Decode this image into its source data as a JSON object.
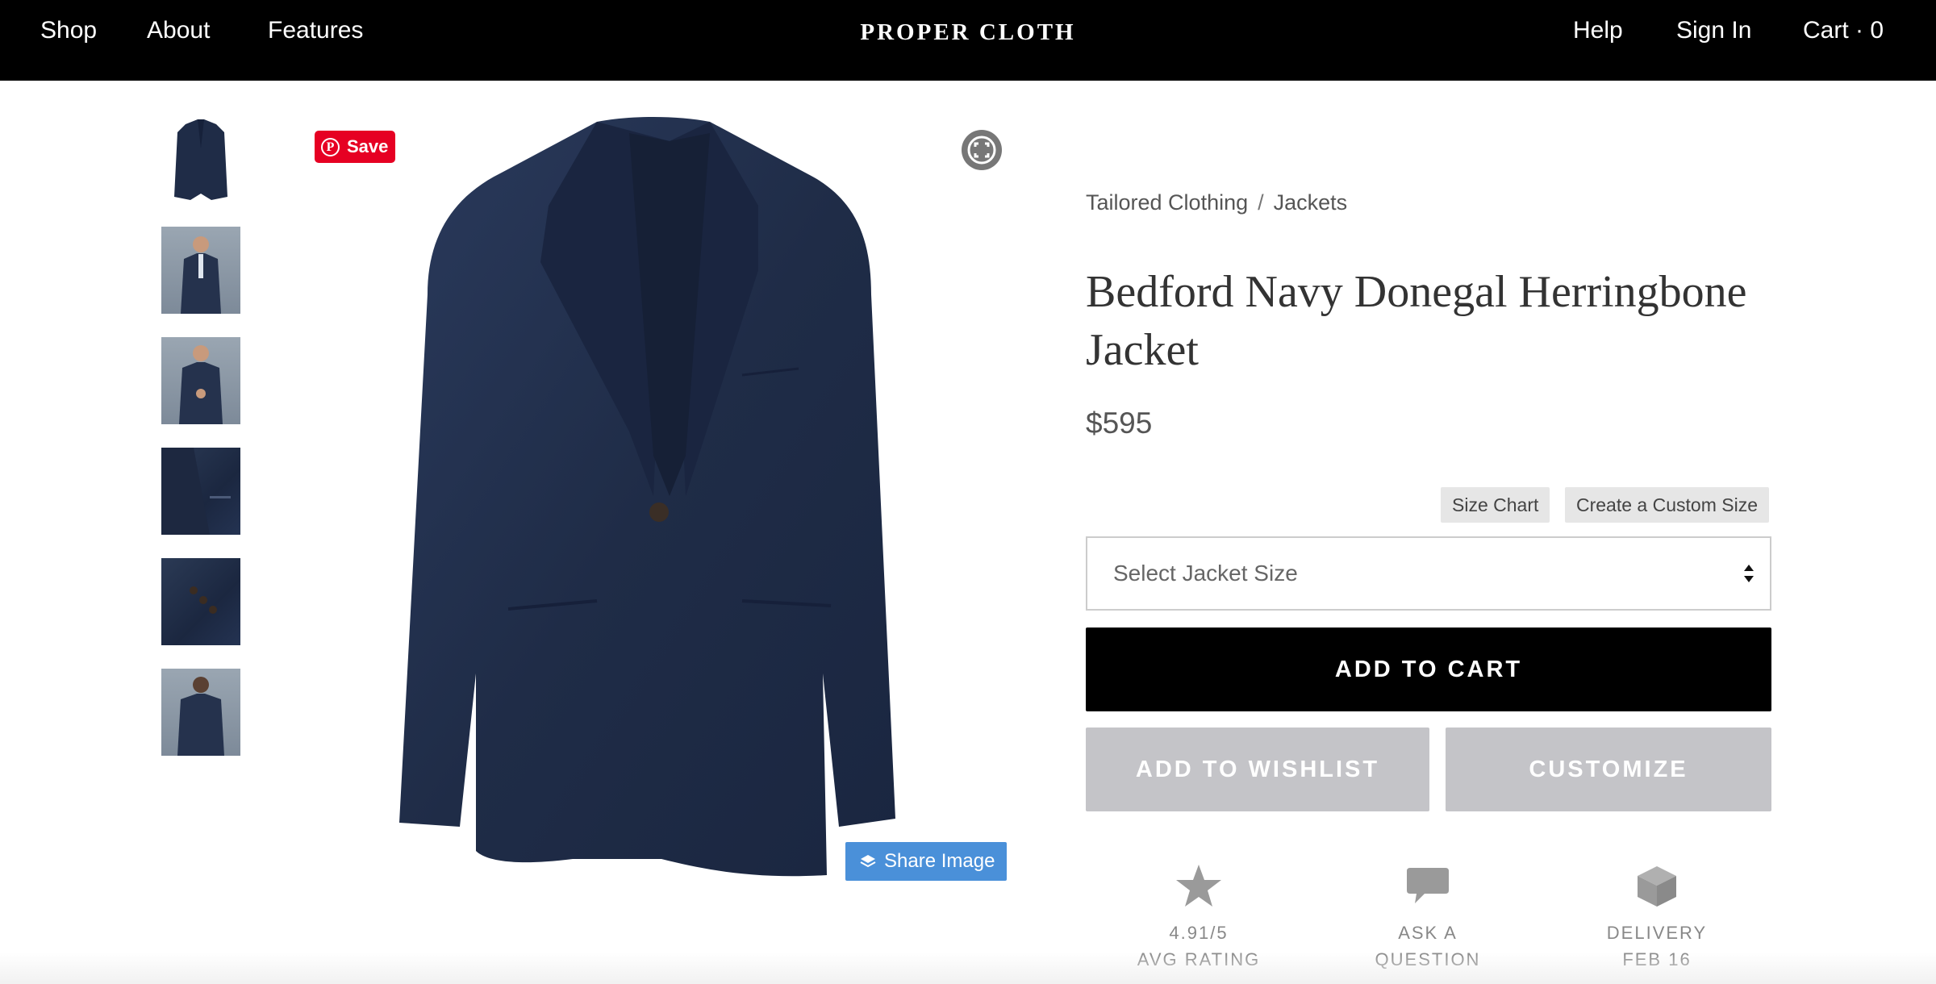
{
  "nav": {
    "left": [
      "Shop",
      "About",
      "Features"
    ],
    "brand": "PROPER CLOTH",
    "right": [
      "Help",
      "Sign In",
      "Cart · 0"
    ]
  },
  "gallery": {
    "thumbnails": [
      {
        "icon": "jacket-front-thumbnail"
      },
      {
        "icon": "model-front-thumbnail"
      },
      {
        "icon": "model-button-thumbnail"
      },
      {
        "icon": "jacket-detail-thumbnail"
      },
      {
        "icon": "cuff-detail-thumbnail"
      },
      {
        "icon": "model-back-thumbnail"
      }
    ],
    "pin_save_label": "Save",
    "share_label": "Share Image",
    "colors": {
      "pinterest": "#e60023",
      "share": "#4a90d9",
      "jacket": "#1f2c47"
    }
  },
  "product": {
    "breadcrumb": [
      "Tailored Clothing",
      "Jackets"
    ],
    "breadcrumb_separator": "/",
    "title_line1": "Bedford Navy Donegal Herringbone",
    "title_line2": "Jacket",
    "price": "$595",
    "size_chart": "Size Chart",
    "custom_size": "Create a Custom Size",
    "select_placeholder": "Select Jacket Size",
    "add_to_cart": "ADD TO CART",
    "add_to_wishlist": "ADD TO WISHLIST",
    "customize": "CUSTOMIZE"
  },
  "features": [
    {
      "icon": "star-icon",
      "line1": "4.91/5",
      "line2": "AVG RATING"
    },
    {
      "icon": "speech-bubble-icon",
      "line1": "ASK A",
      "line2": "QUESTION"
    },
    {
      "icon": "box-icon",
      "line1": "DELIVERY",
      "line2": "FEB 16"
    }
  ]
}
